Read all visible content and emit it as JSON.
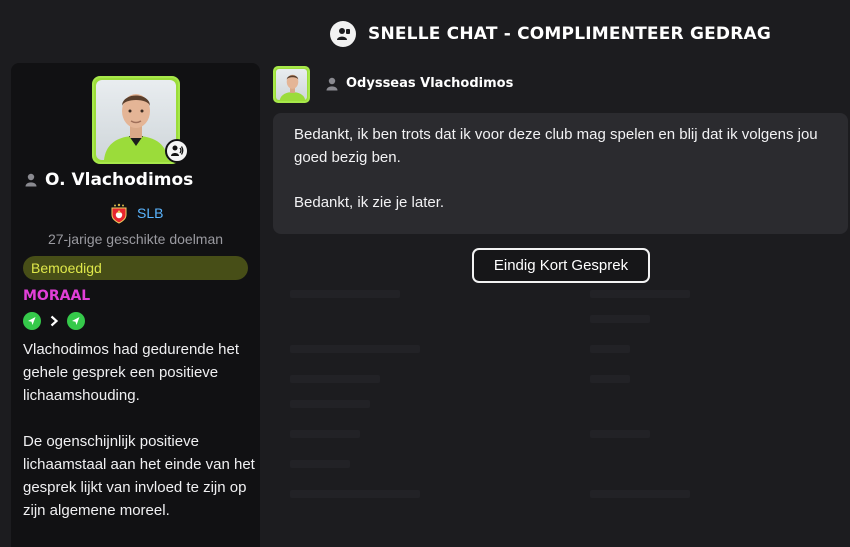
{
  "header": {
    "title": "SNELLE CHAT - COMPLIMENTEER GEDRAG",
    "icon": "player-chat-icon"
  },
  "player_card": {
    "name": "O. Vlachodimos",
    "club": "SLB",
    "description": "27-jarige geschikte doelman",
    "status": "Bemoedigd",
    "morale_label": "MORAAL",
    "morale_change": {
      "from_icon": "morale-good-icon",
      "to_icon": "morale-good-icon"
    },
    "morale_paragraphs": [
      "Vlachodimos had gedurende het gehele gesprek een positieve lichaamshouding.",
      "De ogenschijnlijk positieve lichaamstaal aan het einde van het gesprek lijkt van invloed te zijn op zijn algemene moreel."
    ]
  },
  "chat": {
    "speaker": "Odysseas Vlachodimos",
    "messages": [
      "Bedankt, ik ben trots dat ik voor deze club mag spelen en blij dat ik volgens jou goed bezig ben.",
      "Bedankt, ik zie je later."
    ],
    "end_button": "Eindig Kort Gesprek"
  },
  "colors": {
    "background": "#1c1c1f",
    "panel": "#111113",
    "bubble": "#2b2b2f",
    "status_pill": "#474e17",
    "status_text": "#dfe84a",
    "morale_label": "#e23fd8",
    "morale_good": "#35c94a",
    "club_link": "#5ab5ff",
    "kit": "#9bdc3a"
  }
}
